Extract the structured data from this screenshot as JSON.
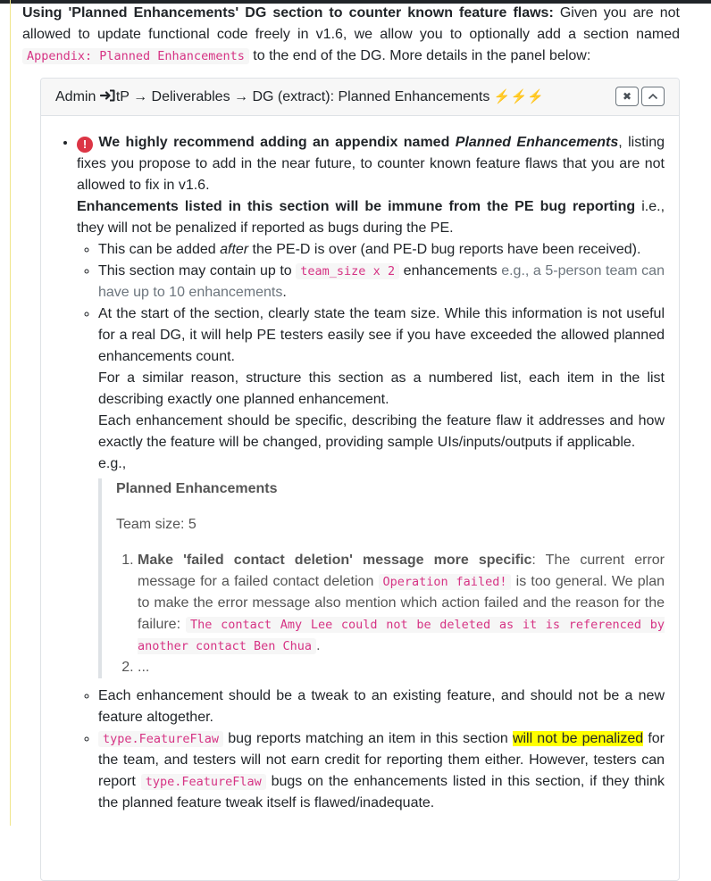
{
  "intro": {
    "bold": "Using 'Planned Enhancements' DG section to counter known feature flaws:",
    "text1": " Given you are not allowed to update functional code freely in v1.6, we allow you to optionally add a section named ",
    "code": "Appendix: Planned Enhancements",
    "text2": " to the end of the DG. More details in the panel below:"
  },
  "panel": {
    "title_pre": "Admin",
    "title_post": "tP → Deliverables → DG (extract): Planned Enhancements",
    "bolts": "⚡⚡⚡",
    "close_label": "✖",
    "collapse_label": "^"
  },
  "main_item": {
    "bold1": "We highly recommend adding an appendix named ",
    "italic": "Planned Enhancements",
    "text1": ", listing fixes you propose to add in the near future, to counter known feature flaws that you are not allowed to fix in v1.6.",
    "bold2": "Enhancements listed in this section will be immune from the PE bug reporting",
    "text2": " i.e., they will not be penalized if reported as bugs during the PE."
  },
  "sub1": {
    "text1": "This can be added ",
    "italic": "after",
    "text2": " the PE-D is over (and PE-D bug reports have been received)."
  },
  "sub2": {
    "text1": "This section may contain up to ",
    "code": "team_size x 2",
    "text2": " enhancements ",
    "grey": "e.g., a 5-person team can have up to 10 enhancements",
    "text3": "."
  },
  "sub3": {
    "para1": "At the start of the section, clearly state the team size. While this information is not useful for a real DG, it will help PE testers easily see if you have exceeded the allowed planned enhancements count.",
    "para2": "For a similar reason, structure this section as a numbered list, each item in the list describing exactly one planned enhancement.",
    "para3": "Each enhancement should be specific, describing the feature flaw it addresses and how exactly the feature will be changed, providing sample UIs/inputs/outputs if applicable.",
    "eg": "e.g.,"
  },
  "example": {
    "title": "Planned Enhancements",
    "team": "Team size: 5",
    "item1_bold": "Make 'failed contact deletion' message more specific",
    "item1_text1": ": The current error message for a failed contact deletion ",
    "item1_code1": "Operation failed!",
    "item1_text2": " is too general. We plan to make the error message also mention which action failed and the reason for the failure: ",
    "item1_code2": "The contact Amy Lee could not be deleted as it is referenced by another contact Ben Chua",
    "item1_text3": ".",
    "item2": "..."
  },
  "sub4": {
    "text": "Each enhancement should be a tweak to an existing feature, and should not be a new feature altogether."
  },
  "sub5": {
    "code1": "type.FeatureFlaw",
    "text1": " bug reports matching an item in this section ",
    "highlight": "will not be penalized",
    "text2": " for the team, and testers will not earn credit for reporting them either. However, testers can report ",
    "code2": "type.FeatureFlaw",
    "text3": " bugs on the enhancements listed in this section, if they think the planned feature tweak itself is flawed/inadequate."
  },
  "colors": {
    "code_text": "#d63384",
    "highlight": "#ffff00",
    "alert_icon": "#dc3545"
  }
}
